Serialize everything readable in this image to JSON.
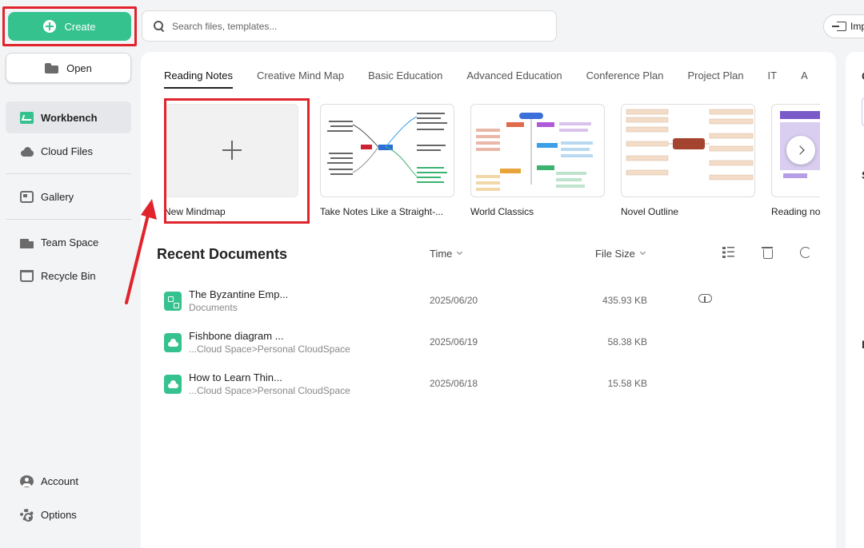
{
  "sidebar": {
    "create_label": "Create",
    "open_label": "Open",
    "items": [
      {
        "label": "Workbench",
        "icon": "workbench-icon"
      },
      {
        "label": "Cloud Files",
        "icon": "cloud-icon"
      },
      {
        "label": "Gallery",
        "icon": "gallery-icon"
      },
      {
        "label": "Team Space",
        "icon": "team-space-icon"
      },
      {
        "label": "Recycle Bin",
        "icon": "recycle-bin-icon"
      }
    ],
    "bottom": [
      {
        "label": "Account",
        "icon": "account-icon"
      },
      {
        "label": "Options",
        "icon": "gear-icon"
      }
    ]
  },
  "search": {
    "placeholder": "Search files, templates..."
  },
  "header": {
    "import_label": "Imp"
  },
  "tabs": [
    "Reading Notes",
    "Creative Mind Map",
    "Basic Education",
    "Advanced Education",
    "Conference Plan",
    "Project Plan",
    "IT",
    "A"
  ],
  "templates": [
    {
      "label": "New Mindmap"
    },
    {
      "label": "Take Notes Like a Straight-..."
    },
    {
      "label": "World Classics"
    },
    {
      "label": "Novel Outline"
    },
    {
      "label": "Reading no"
    }
  ],
  "recent": {
    "title": "Recent Documents",
    "col_time": "Time",
    "col_size": "File Size",
    "docs": [
      {
        "name": "The Byzantine Emp...",
        "location": "Documents",
        "time": "2025/06/20",
        "size": "435.93 KB"
      },
      {
        "name": "Fishbone diagram ...",
        "location": "...Cloud Space>Personal CloudSpace",
        "time": "2025/06/19",
        "size": "58.38 KB"
      },
      {
        "name": "How to Learn Thin...",
        "location": "...Cloud Space>Personal CloudSpace",
        "time": "2025/06/18",
        "size": "15.58 KB"
      }
    ]
  },
  "right_panel": {
    "mark1": "C",
    "mark2": "S",
    "mark3": "I"
  },
  "colors": {
    "accent": "#35c28e",
    "highlight": "#e0242b"
  }
}
